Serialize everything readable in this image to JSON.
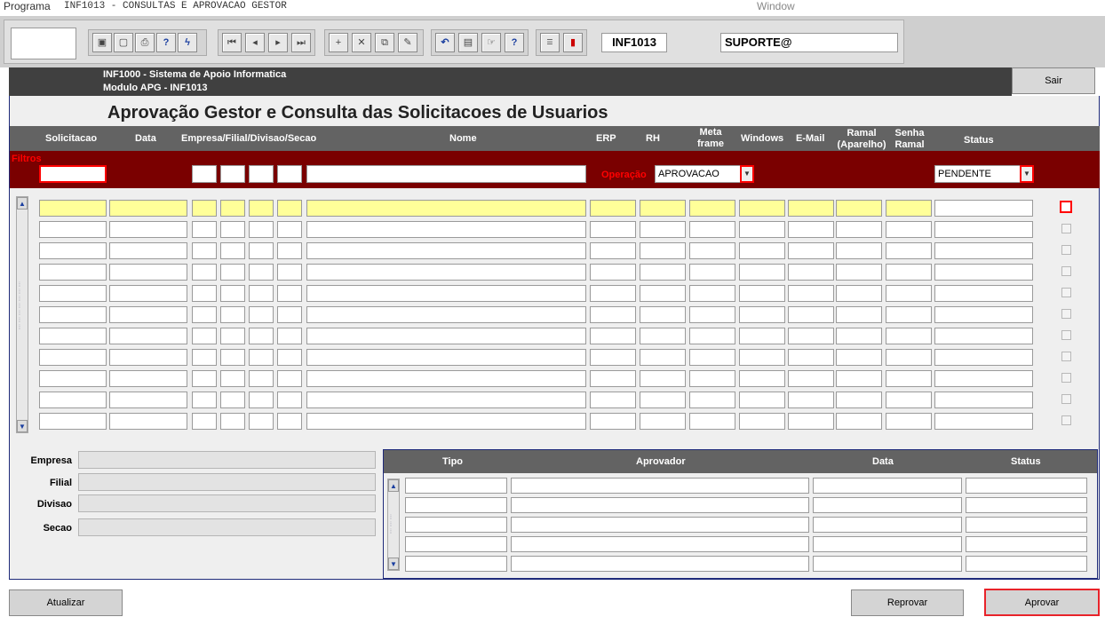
{
  "menubar": {
    "programa": "Programa",
    "title": "INF1013 - CONSULTAS E APROVACAO GESTOR",
    "window": "Window"
  },
  "toolbar": {
    "code": "INF1013",
    "user": "SUPORTE@",
    "icons": [
      "save-icon",
      "print-preview-icon",
      "printer-icon",
      "help-query-icon",
      "enter-query-icon",
      "first-record-icon",
      "previous-record-icon",
      "next-record-icon",
      "last-record-icon",
      "insert-record-icon",
      "delete-record-icon",
      "duplicate-record-icon",
      "edit-icon",
      "undo-icon",
      "clipboard-icon",
      "keyboard-help-icon",
      "question-mark-icon",
      "menu-icon",
      "exit-icon"
    ]
  },
  "header": {
    "system": "INF1000 - Sistema de Apoio Informatica",
    "module": "Modulo APG - INF1013",
    "sair": "Sair"
  },
  "page_title": "Aprovação Gestor e Consulta das Solicitacoes de Usuarios",
  "columns": {
    "solicitacao": "Solicitacao",
    "data": "Data",
    "empresa": "Empresa/Filial/Divisao/Secao",
    "nome": "Nome",
    "erp": "ERP",
    "rh": "RH",
    "metaframe": "Meta frame",
    "windows": "Windows",
    "email": "E-Mail",
    "ramal": "Ramal (Aparelho)",
    "senha": "Senha Ramal",
    "status": "Status"
  },
  "filters": {
    "label": "Filtros",
    "operacao_label": "Operação",
    "operacao_value": "APROVACAO",
    "status_value": "PENDENTE"
  },
  "details": {
    "empresa": "Empresa",
    "filial": "Filial",
    "divisao": "Divisao",
    "secao": "Secao"
  },
  "approvals": {
    "tipo": "Tipo",
    "aprovador": "Aprovador",
    "data": "Data",
    "status": "Status"
  },
  "buttons": {
    "atualizar": "Atualizar",
    "reprovar": "Reprovar",
    "aprovar": "Aprovar"
  }
}
